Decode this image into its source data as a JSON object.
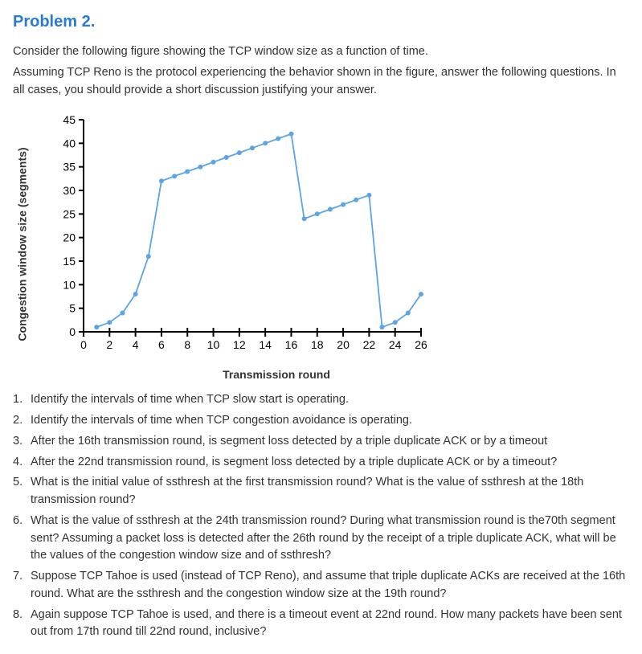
{
  "title": "Problem 2.",
  "intro": [
    "Consider the following figure showing the TCP window size as a function of time.",
    "Assuming TCP Reno is the protocol experiencing the behavior shown in the figure, answer the following questions. In all cases, you should provide a short discussion justifying your answer."
  ],
  "chart_data": {
    "type": "line",
    "xlabel": "Transmission round",
    "ylabel": "Congestion window size (segments)",
    "x": [
      1,
      2,
      3,
      4,
      5,
      6,
      7,
      8,
      9,
      10,
      11,
      12,
      13,
      14,
      15,
      16,
      17,
      18,
      19,
      20,
      21,
      22,
      23,
      24,
      25,
      26
    ],
    "y": [
      1,
      2,
      4,
      8,
      16,
      32,
      33,
      34,
      35,
      36,
      37,
      38,
      39,
      40,
      41,
      42,
      24,
      25,
      26,
      27,
      28,
      29,
      1,
      2,
      4,
      8
    ],
    "xlim": [
      0,
      26
    ],
    "ylim": [
      0,
      45
    ],
    "xticks": [
      0,
      2,
      4,
      6,
      8,
      10,
      12,
      14,
      16,
      18,
      20,
      22,
      24,
      26
    ],
    "yticks": [
      0,
      5,
      10,
      15,
      20,
      25,
      30,
      35,
      40,
      45
    ]
  },
  "questions": [
    "Identify the intervals of time when TCP slow start is operating.",
    "Identify the intervals of time when TCP congestion avoidance is operating.",
    "After the 16th transmission round, is segment loss detected by a triple duplicate ACK or by a timeout",
    "After the 22nd transmission round, is segment loss detected by a triple duplicate ACK or by a timeout?",
    "What is the initial value of ssthresh at the first transmission round? What is the value of ssthresh at the 18th transmission round?",
    "What is the value of ssthresh at the 24th transmission round? During what transmission round is the70th segment sent? Assuming a packet loss is detected after the 26th round by the receipt of a triple duplicate ACK, what will be the values of the congestion window size and of ssthresh?",
    "Suppose TCP Tahoe is used (instead of TCP Reno), and assume that triple duplicate ACKs are received at the 16th round. What are the ssthresh and the congestion window size at the 19th round?",
    "Again suppose TCP Tahoe is used, and there is a timeout event at 22nd round. How many packets have been sent out from 17th round till 22nd round, inclusive?"
  ]
}
